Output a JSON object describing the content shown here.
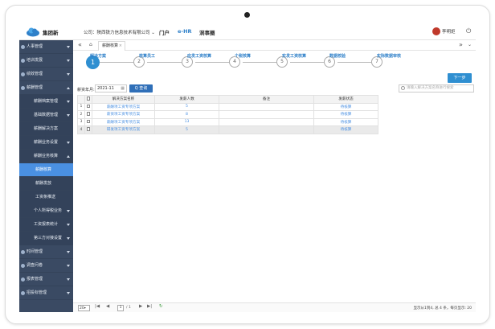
{
  "device": {
    "power_glyph": "⏻"
  },
  "header": {
    "brand": "集团新",
    "company_label": "公司：陕西铁力信息技术有限公司",
    "nav": [
      "门户",
      "e-HR",
      "洞事圈"
    ],
    "user": "李明炬"
  },
  "sidebar": {
    "items": [
      {
        "label": "人事管理",
        "level": 1,
        "arrow": "down"
      },
      {
        "label": "培训发展",
        "level": 1,
        "arrow": "down"
      },
      {
        "label": "绩效管理",
        "level": 1,
        "arrow": "down"
      },
      {
        "label": "薪酬管理",
        "level": 1,
        "arrow": "up"
      },
      {
        "label": "薪酬档案管理",
        "level": 2,
        "arrow": "down"
      },
      {
        "label": "基础数据管理",
        "level": 2,
        "arrow": "down"
      },
      {
        "label": "薪酬解决方案",
        "level": 2,
        "arrow": ""
      },
      {
        "label": "薪酬业务设置",
        "level": 2,
        "arrow": "down"
      },
      {
        "label": "薪酬业务核算",
        "level": 2,
        "arrow": "up"
      },
      {
        "label": "薪酬核算",
        "level": 3,
        "arrow": "",
        "active": true
      },
      {
        "label": "薪酬发放",
        "level": 3,
        "arrow": ""
      },
      {
        "label": "工资条推送",
        "level": 3,
        "arrow": ""
      },
      {
        "label": "个人所得税业务",
        "level": 2,
        "arrow": "down"
      },
      {
        "label": "工资报表统计",
        "level": 2,
        "arrow": "down"
      },
      {
        "label": "第三方对接设置",
        "level": 2,
        "arrow": "down"
      },
      {
        "label": "时间管理",
        "level": 1,
        "arrow": "down"
      },
      {
        "label": "调查问卷",
        "level": 1,
        "arrow": "down"
      },
      {
        "label": "报表管理",
        "level": 1,
        "arrow": "down"
      },
      {
        "label": "招投标管理",
        "level": 1,
        "arrow": "down"
      }
    ]
  },
  "tabs": {
    "active": "薪酬核算",
    "close": "×",
    "prev": "«",
    "next": "»"
  },
  "steps": [
    {
      "n": "1",
      "label": "解决方案"
    },
    {
      "n": "2",
      "label": "核算员工"
    },
    {
      "n": "3",
      "label": "应发工资核算"
    },
    {
      "n": "4",
      "label": "个税核算"
    },
    {
      "n": "5",
      "label": "实发工资核算"
    },
    {
      "n": "6",
      "label": "数据校验"
    },
    {
      "n": "7",
      "label": "实际数据审核"
    }
  ],
  "toolbar": {
    "next_label": "下一步",
    "period_label": "薪资年月:",
    "period_value": "2021-11",
    "search_label": "Q 查询",
    "keyword_placeholder": "请输入解决方案名称进行搜索"
  },
  "table": {
    "headers": [
      "",
      "解决方案名称",
      "发薪人数",
      "备注",
      "发薪状态"
    ],
    "rows": [
      {
        "no": "1",
        "name": "薪酬项工资专项方案",
        "count": "5",
        "remark": "",
        "status": "待核算"
      },
      {
        "no": "2",
        "name": "薪资项工资专项方案",
        "count": "8",
        "remark": "",
        "status": "待核算"
      },
      {
        "no": "3",
        "name": "薪酬项工资专项方案",
        "count": "13",
        "remark": "",
        "status": "待核算"
      },
      {
        "no": "4",
        "name": "研发项工资专项方案",
        "count": "5",
        "remark": "",
        "status": "待核算"
      }
    ]
  },
  "pager": {
    "page_size": "20",
    "page": "1",
    "total_pages": "/ 1",
    "info": "显示从1到4, 总 4 条，每页显示: 20",
    "first": "|◀",
    "prev": "◀",
    "next": "▶",
    "last": "▶|",
    "refresh": "↻"
  }
}
